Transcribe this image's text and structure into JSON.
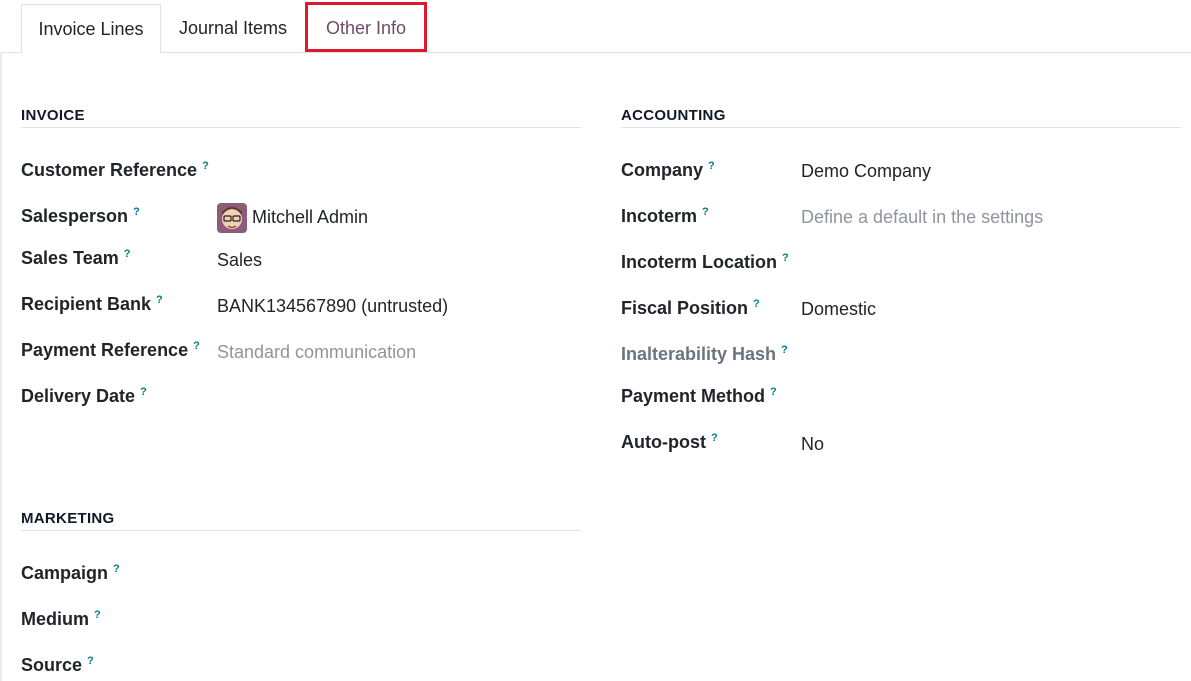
{
  "tabs": [
    {
      "label": "Invoice Lines"
    },
    {
      "label": "Journal Items"
    },
    {
      "label": "Other Info"
    }
  ],
  "invoice": {
    "title": "INVOICE",
    "customer_reference": {
      "label": "Customer Reference",
      "value": ""
    },
    "salesperson": {
      "label": "Salesperson",
      "value": "Mitchell Admin"
    },
    "sales_team": {
      "label": "Sales Team",
      "value": "Sales"
    },
    "recipient_bank": {
      "label": "Recipient Bank",
      "value": "BANK134567890 (untrusted)"
    },
    "payment_reference": {
      "label": "Payment Reference",
      "placeholder": "Standard communication"
    },
    "delivery_date": {
      "label": "Delivery Date",
      "value": ""
    }
  },
  "marketing": {
    "title": "MARKETING",
    "campaign": {
      "label": "Campaign"
    },
    "medium": {
      "label": "Medium"
    },
    "source": {
      "label": "Source"
    }
  },
  "accounting": {
    "title": "ACCOUNTING",
    "company": {
      "label": "Company",
      "value": "Demo Company"
    },
    "incoterm": {
      "label": "Incoterm",
      "placeholder": "Define a default in the settings"
    },
    "incoterm_location": {
      "label": "Incoterm Location"
    },
    "fiscal_position": {
      "label": "Fiscal Position",
      "value": "Domestic"
    },
    "inalterability_hash": {
      "label": "Inalterability Hash"
    },
    "payment_method": {
      "label": "Payment Method"
    },
    "auto_post": {
      "label": "Auto-post",
      "value": "No"
    }
  },
  "help_mark": "?",
  "colors": {
    "accent": "#714b67",
    "highlight": "#e0182c",
    "help": "#017e84"
  }
}
